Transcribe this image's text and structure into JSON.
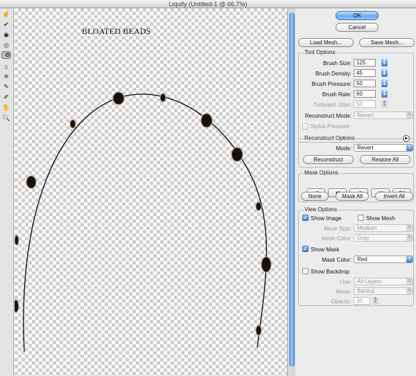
{
  "window": {
    "title": "Liquify (Untitled-1 @ 66.7%)"
  },
  "toolbox": {
    "tools": [
      {
        "name": "warp-icon",
        "glyph": "☝",
        "selected": false
      },
      {
        "name": "reconstruct-icon",
        "glyph": "✔",
        "selected": false
      },
      {
        "name": "twirl-cw-icon",
        "glyph": "◉",
        "selected": false
      },
      {
        "name": "pucker-icon",
        "glyph": "◎",
        "selected": false
      },
      {
        "name": "bloat-icon",
        "glyph": "❂",
        "selected": true
      },
      {
        "name": "push-left-icon",
        "glyph": "⇶",
        "selected": false
      },
      {
        "name": "mirror-icon",
        "glyph": "⌂",
        "selected": false
      },
      {
        "name": "turbulence-icon",
        "glyph": "≋",
        "selected": false
      },
      {
        "name": "freeze-mask-icon",
        "glyph": "✎",
        "selected": false
      },
      {
        "name": "thaw-mask-icon",
        "glyph": "✐",
        "selected": false
      },
      {
        "name": "hand-icon",
        "glyph": "✋",
        "selected": false
      },
      {
        "name": "zoom-icon",
        "glyph": "🔍",
        "selected": false
      }
    ]
  },
  "canvas": {
    "caption": "BLOATED BEADS"
  },
  "buttons": {
    "ok": "OK",
    "cancel": "Cancel",
    "load_mesh": "Load Mesh...",
    "save_mesh": "Save Mesh..."
  },
  "tool_options": {
    "label": "Tool Options",
    "brush_size_label": "Brush Size:",
    "brush_size": "125",
    "brush_density_label": "Brush Density:",
    "brush_density": "45",
    "brush_pressure_label": "Brush Pressure:",
    "brush_pressure": "50",
    "brush_rate_label": "Brush Rate:",
    "brush_rate": "60",
    "turbulent_jitter_label": "Turbulent Jitter:",
    "turbulent_jitter": "50",
    "reconstruct_mode_label": "Reconstruct Mode:",
    "reconstruct_mode": "Revert",
    "stylus_pressure_label": "Stylus Pressure"
  },
  "reconstruct_options": {
    "label": "Reconstruct Options",
    "mode_label": "Mode:",
    "mode": "Revert",
    "reconstruct_button": "Reconstruct",
    "restore_all_button": "Restore All"
  },
  "mask_options": {
    "label": "Mask Options",
    "mode_icons": [
      "replace-selection-icon",
      "add-to-selection-icon",
      "subtract-from-selection-icon",
      "intersect-selection-icon",
      "invert-selection-icon"
    ],
    "none_button": "None",
    "mask_all_button": "Mask All",
    "invert_all_button": "Invert All"
  },
  "view_options": {
    "label": "View Options",
    "show_image_label": "Show Image",
    "show_image": true,
    "show_mesh_label": "Show Mesh",
    "show_mesh": false,
    "mesh_size_label": "Mesh Size:",
    "mesh_size": "Medium",
    "mesh_color_label": "Mesh Color:",
    "mesh_color": "Gray",
    "show_mask_label": "Show Mask",
    "show_mask": true,
    "mask_color_label": "Mask Color:",
    "mask_color": "Red",
    "show_backdrop_label": "Show Backdrop",
    "show_backdrop": false,
    "use_label": "Use:",
    "use": "All Layers",
    "mode_label": "Mode:",
    "mode": "Behind",
    "opacity_label": "Opacity:",
    "opacity": "30"
  },
  "colors": {
    "accent": "#4e8ee0",
    "bead": "#111111",
    "bead_cap": "#b8906e"
  }
}
